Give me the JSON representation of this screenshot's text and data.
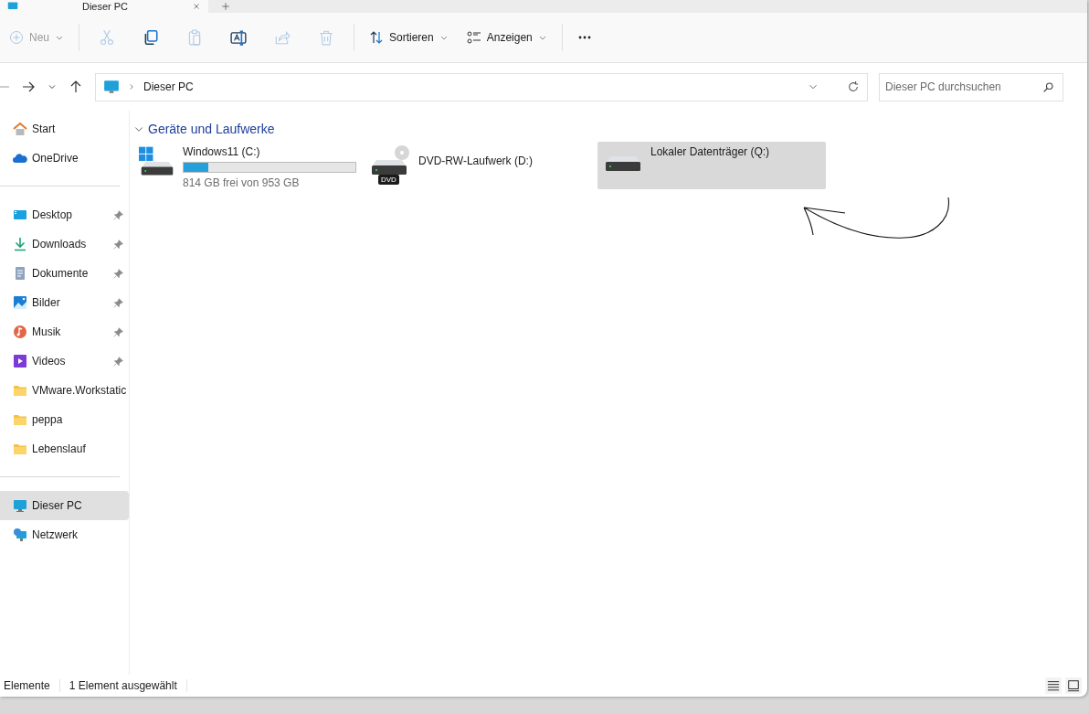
{
  "tabs": [
    {
      "title": "Dieser PC",
      "selected": true
    }
  ],
  "toolbar": {
    "new_label": "Neu",
    "new_disabled": true,
    "actions": [
      {
        "kind": "cut",
        "disabled": true
      },
      {
        "kind": "copy",
        "disabled": false
      },
      {
        "kind": "paste",
        "disabled": true
      },
      {
        "kind": "rename",
        "disabled": false
      },
      {
        "kind": "share",
        "disabled": true
      },
      {
        "kind": "delete",
        "disabled": true
      }
    ],
    "sort_label": "Sortieren",
    "view_label": "Anzeigen"
  },
  "address": {
    "path": "Dieser PC",
    "search_placeholder": "Dieser PC durchsuchen"
  },
  "sidebar": {
    "sections": [
      [
        {
          "label": "Start",
          "kind": "home",
          "pinned": false,
          "selected": false
        },
        {
          "label": "OneDrive",
          "kind": "cloud",
          "pinned": false,
          "selected": false
        }
      ],
      [
        {
          "label": "Desktop",
          "kind": "desktop",
          "pinned": true,
          "selected": false
        },
        {
          "label": "Downloads",
          "kind": "download",
          "pinned": true,
          "selected": false
        },
        {
          "label": "Dokumente",
          "kind": "documents",
          "pinned": true,
          "selected": false
        },
        {
          "label": "Bilder",
          "kind": "pictures",
          "pinned": true,
          "selected": false
        },
        {
          "label": "Musik",
          "kind": "music",
          "pinned": true,
          "selected": false
        },
        {
          "label": "Videos",
          "kind": "videos",
          "pinned": true,
          "selected": false
        },
        {
          "label": "VMware.Workstatic",
          "kind": "folder",
          "pinned": false,
          "selected": false
        },
        {
          "label": "peppa",
          "kind": "folder",
          "pinned": false,
          "selected": false
        },
        {
          "label": "Lebenslauf",
          "kind": "folder",
          "pinned": false,
          "selected": false
        }
      ],
      [
        {
          "label": "Dieser PC",
          "kind": "pc",
          "pinned": false,
          "selected": true
        },
        {
          "label": "Netzwerk",
          "kind": "network",
          "pinned": false,
          "selected": false
        }
      ]
    ]
  },
  "section_title": "Geräte und Laufwerke",
  "drives": [
    {
      "kind": "system",
      "name": "Windows11 (C:)",
      "level": 0.146,
      "free": "814 GB frei von 953 GB",
      "selected": false
    },
    {
      "kind": "dvd",
      "name": "DVD-RW-Laufwerk (D:)",
      "badge": "DVD",
      "selected": false
    },
    {
      "kind": "local",
      "name": "Lokaler Datenträger (Q:)",
      "selected": true
    }
  ],
  "status_bar": {
    "count": "Elemente",
    "selection": "1 Element ausgewählt"
  }
}
